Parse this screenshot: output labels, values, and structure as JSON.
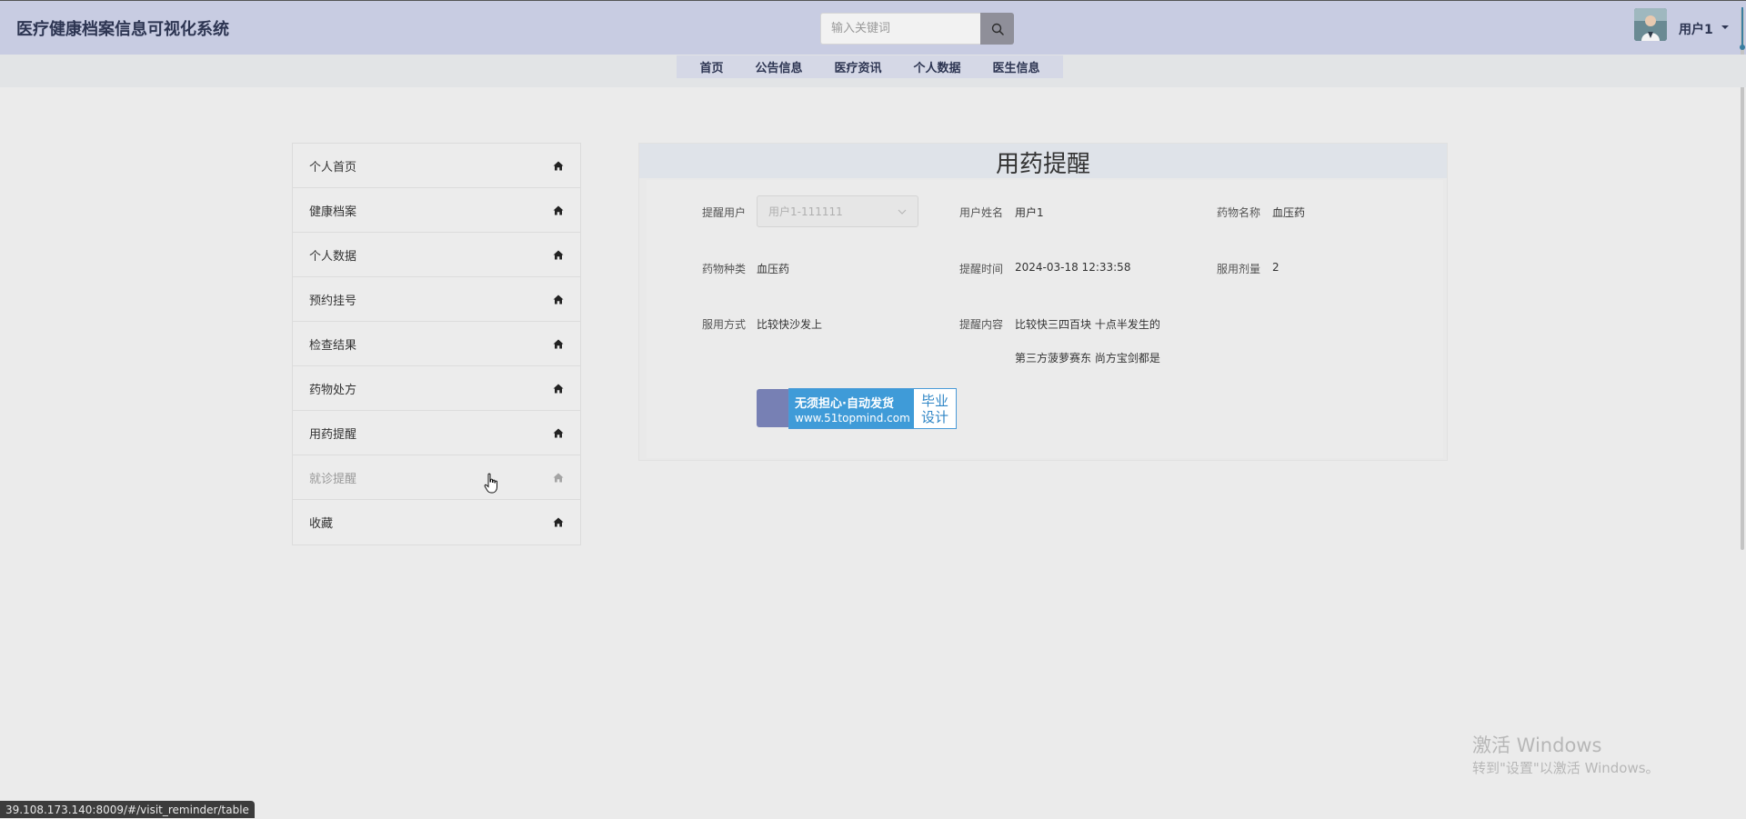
{
  "header": {
    "app_title": "医疗健康档案信息可视化系统",
    "search_placeholder": "输入关键词",
    "user_name": "用户1"
  },
  "nav": {
    "items": [
      "首页",
      "公告信息",
      "医疗资讯",
      "个人数据",
      "医生信息"
    ]
  },
  "sidebar": {
    "items": [
      {
        "label": "个人首页"
      },
      {
        "label": "健康档案"
      },
      {
        "label": "个人数据"
      },
      {
        "label": "预约挂号"
      },
      {
        "label": "检查结果"
      },
      {
        "label": "药物处方"
      },
      {
        "label": "用药提醒"
      },
      {
        "label": "就诊提醒",
        "state": "hover"
      },
      {
        "label": "收藏"
      }
    ]
  },
  "form": {
    "title": "用药提醒",
    "reminder_user": {
      "label": "提醒用户",
      "value": "用户1-111111"
    },
    "user_name": {
      "label": "用户姓名",
      "value": "用户1"
    },
    "drug_name": {
      "label": "药物名称",
      "value": "血压药"
    },
    "drug_type": {
      "label": "药物种类",
      "value": "血压药"
    },
    "reminder_time": {
      "label": "提醒时间",
      "value": "2024-03-18 12:33:58"
    },
    "dosage": {
      "label": "服用剂量",
      "value": "2"
    },
    "usage_method": {
      "label": "服用方式",
      "value": "比较快沙发上"
    },
    "reminder_content": {
      "label": "提醒内容",
      "line1": "比较快三四百块 十点半发生的",
      "line2": "第三方菠萝赛东 尚方宝剑都是"
    }
  },
  "ad_badge": {
    "line1": "无须担心·自动发货",
    "line2": "www.51topmind.com",
    "right_top": "毕业",
    "right_bottom": "设计"
  },
  "watermark": {
    "title": "激活 Windows",
    "subtitle": "转到\"设置\"以激活 Windows。"
  },
  "status_bar": {
    "url": "39.108.173.140:8009/#/visit_reminder/table"
  },
  "colors": {
    "header_bg": "#c8cce2",
    "nav_bg": "#d5d8e6",
    "page_bg": "#ebebeb",
    "accent_button": "#7780b4",
    "ad_blue": "#3f9bd8"
  },
  "icons": {
    "search": "search-icon",
    "sidebar_item": "home-icon",
    "select_arrow": "chevron-down-icon",
    "pointer": "hand-cursor-icon"
  }
}
